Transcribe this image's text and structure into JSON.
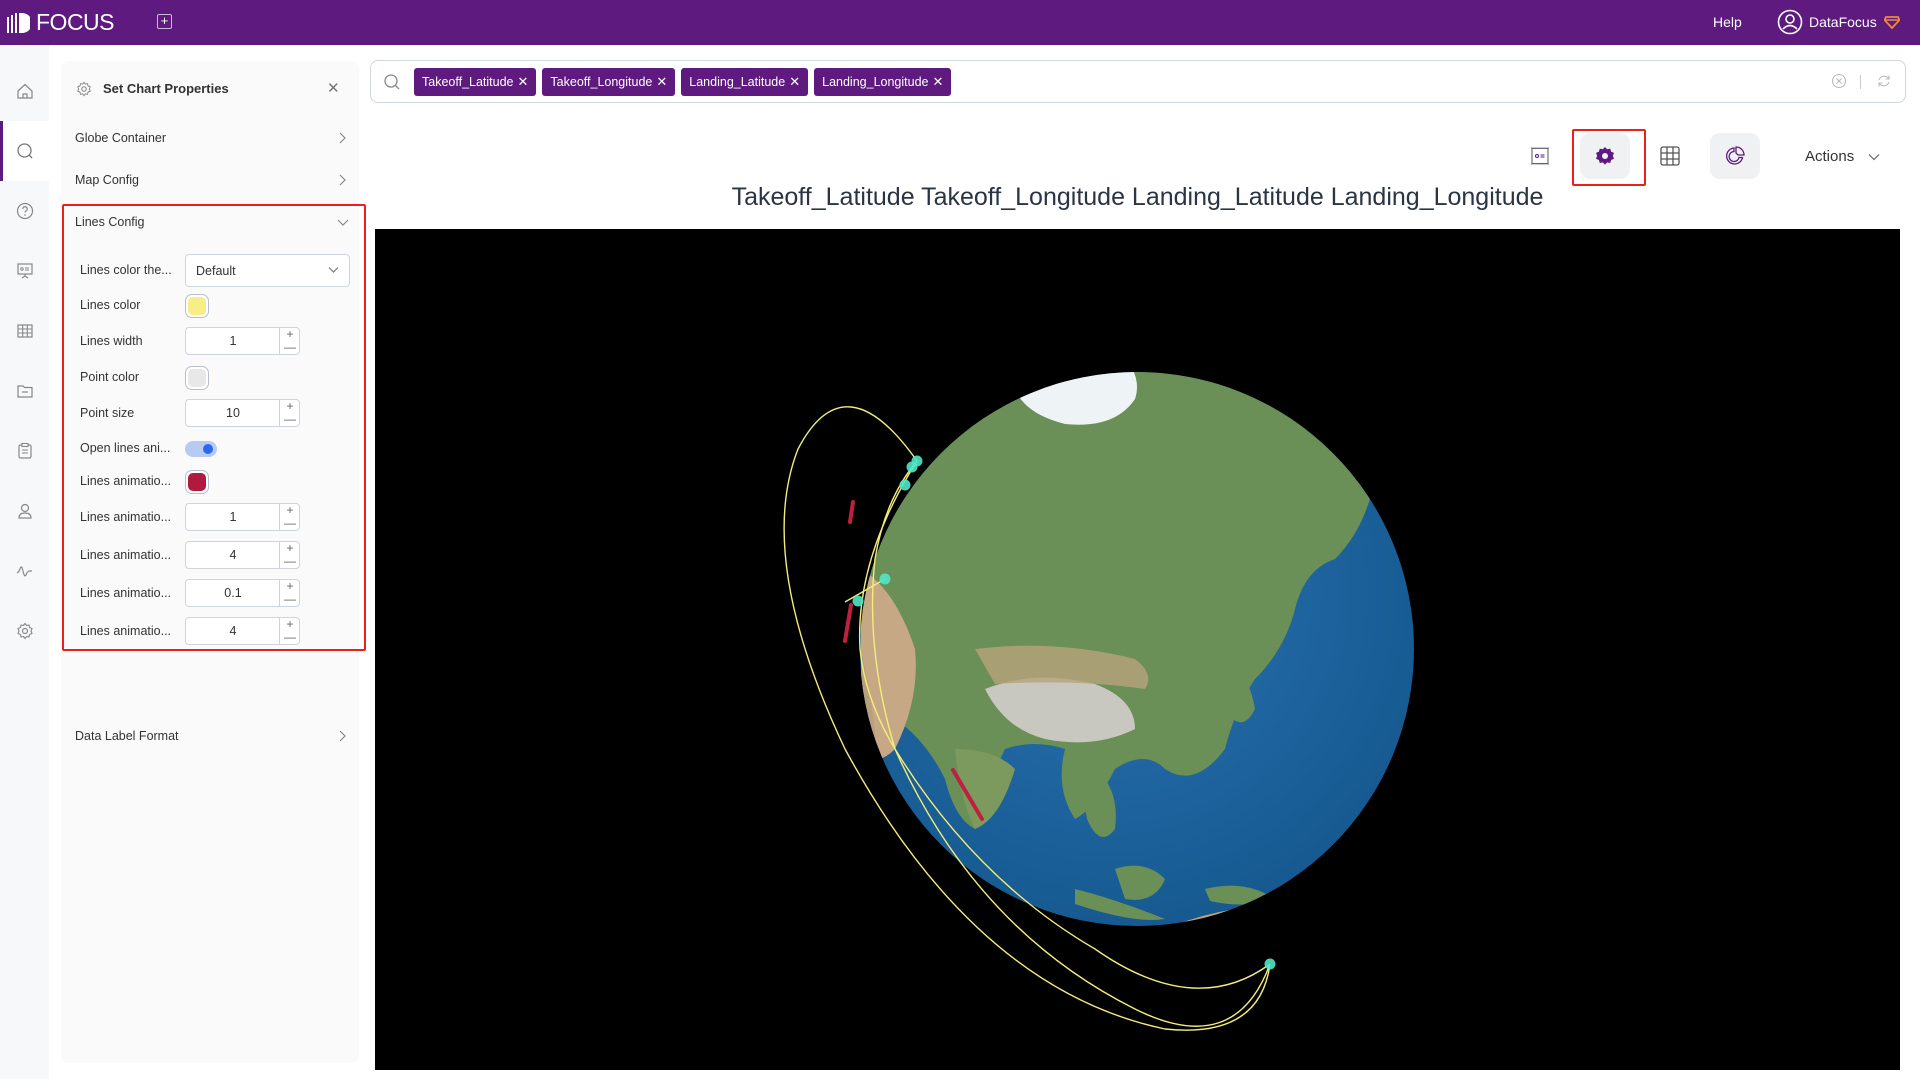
{
  "app": {
    "brand": "FOCUS",
    "help_label": "Help",
    "user_name": "DataFocus"
  },
  "nav": {
    "items": [
      {
        "name": "home",
        "icon": "home-icon"
      },
      {
        "name": "search",
        "icon": "search-icon",
        "active": true
      },
      {
        "name": "help",
        "icon": "question-icon"
      },
      {
        "name": "dashboard",
        "icon": "presentation-icon"
      },
      {
        "name": "table",
        "icon": "grid-icon"
      },
      {
        "name": "folder",
        "icon": "folder-icon"
      },
      {
        "name": "clipboard",
        "icon": "clipboard-icon"
      },
      {
        "name": "user",
        "icon": "user-icon"
      },
      {
        "name": "monitor",
        "icon": "pulse-icon"
      },
      {
        "name": "settings",
        "icon": "gear-icon"
      }
    ]
  },
  "panel": {
    "title": "Set Chart Properties",
    "sections": {
      "globe_container": "Globe Container",
      "map_config": "Map Config",
      "lines_config": "Lines Config",
      "data_label_format": "Data Label Format"
    },
    "lines_config": {
      "color_theme": {
        "label": "Lines color the...",
        "value": "Default"
      },
      "lines_color": {
        "label": "Lines color",
        "color": "#f7ee86"
      },
      "lines_width": {
        "label": "Lines width",
        "value": "1"
      },
      "point_color": {
        "label": "Point color",
        "color": "#e8e8e8"
      },
      "point_size": {
        "label": "Point size",
        "value": "10"
      },
      "open_animation": {
        "label": "Open lines ani...",
        "on": true
      },
      "animation_color": {
        "label": "Lines animatio...",
        "color": "#b01a3e"
      },
      "animation_1": {
        "label": "Lines animatio...",
        "value": "1"
      },
      "animation_2": {
        "label": "Lines animatio...",
        "value": "4"
      },
      "animation_3": {
        "label": "Lines animatio...",
        "value": "0.1"
      },
      "animation_4": {
        "label": "Lines animatio...",
        "value": "4"
      }
    }
  },
  "search": {
    "chips": [
      "Takeoff_Latitude",
      "Takeoff_Longitude",
      "Landing_Latitude",
      "Landing_Longitude"
    ]
  },
  "toolbar": {
    "actions_label": "Actions"
  },
  "chart": {
    "title": "Takeoff_Latitude Takeoff_Longitude Landing_Latitude Landing_Longitude"
  },
  "colors": {
    "brand": "#5e1a7e",
    "highlight": "#e8221b",
    "ocean": "#1d62a0",
    "line": "#f2ec7c",
    "point": "#4fe7c8",
    "trail": "#c0203f"
  }
}
